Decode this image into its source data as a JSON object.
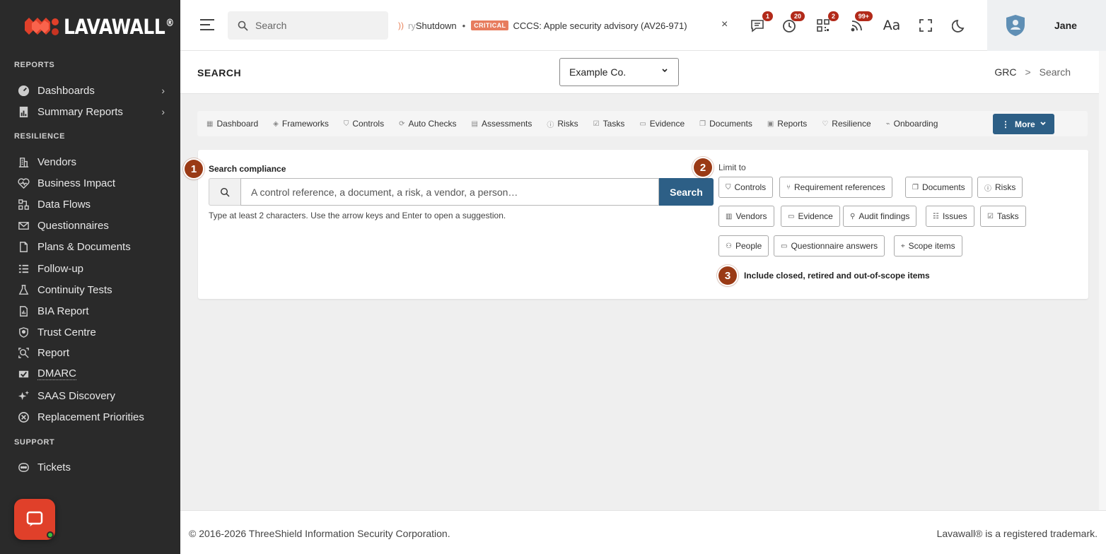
{
  "app": {
    "brand": "LAVAWALL",
    "brand_reg": "®",
    "brand_color": "#e0402a"
  },
  "sidebar": {
    "sections": {
      "reports": "REPORTS",
      "resilience": "RESILIENCE",
      "support": "SUPPORT"
    },
    "items": [
      {
        "label": "Dashboards",
        "icon": "gauge-icon"
      },
      {
        "label": "Summary Reports",
        "icon": "report-icon"
      },
      {
        "label": "Vendors",
        "icon": "building-icon"
      },
      {
        "label": "Business Impact",
        "icon": "heart-pulse-icon"
      },
      {
        "label": "Data Flows",
        "icon": "flow-icon"
      },
      {
        "label": "Questionnaires",
        "icon": "envelope-icon"
      },
      {
        "label": "Plans & Documents",
        "icon": "document-icon"
      },
      {
        "label": "Follow-up",
        "icon": "list-icon"
      },
      {
        "label": "Continuity Tests",
        "icon": "flask-icon"
      },
      {
        "label": "BIA Report",
        "icon": "chart-icon"
      },
      {
        "label": "Trust Centre",
        "icon": "shield-icon"
      },
      {
        "label": "Report",
        "icon": "search-report-icon"
      },
      {
        "label": "DMARC",
        "icon": "mail-check-icon"
      },
      {
        "label": "SAAS Discovery",
        "icon": "sparkle-icon"
      },
      {
        "label": "Replacement Priorities",
        "icon": "priority-icon"
      },
      {
        "label": "Tickets",
        "icon": "ticket-icon"
      }
    ]
  },
  "topbar": {
    "search_placeholder": "Search",
    "ticker": {
      "faded_prefix": "ry",
      "first_item": "Shutdown",
      "severity": "CRITICAL",
      "second_item": "CCCS: Apple security advisory (AV26-971)",
      "close": "×"
    },
    "badges": {
      "messages": "1",
      "timer": "20",
      "qr": "2",
      "feeds": "99+"
    },
    "font_icon_text": "Aa",
    "user_name": "Jane"
  },
  "page": {
    "title": "SEARCH",
    "company": "Example Co.",
    "breadcrumb": [
      "GRC",
      "Search"
    ],
    "breadcrumb_sep": ">"
  },
  "tabs": [
    {
      "label": "Dashboard",
      "icon": "grid-icon"
    },
    {
      "label": "Frameworks",
      "icon": "layers-icon"
    },
    {
      "label": "Controls",
      "icon": "shield-check-icon"
    },
    {
      "label": "Auto Checks",
      "icon": "auto-icon"
    },
    {
      "label": "Assessments",
      "icon": "clipboard-icon"
    },
    {
      "label": "Risks",
      "icon": "alert-icon"
    },
    {
      "label": "Tasks",
      "icon": "checkbox-icon"
    },
    {
      "label": "Evidence",
      "icon": "folder-icon"
    },
    {
      "label": "Documents",
      "icon": "docs-icon"
    },
    {
      "label": "Reports",
      "icon": "report-icon"
    },
    {
      "label": "Resilience",
      "icon": "heart-icon"
    },
    {
      "label": "Onboarding",
      "icon": "onboarding-icon"
    }
  ],
  "more_button": "More",
  "search_panel": {
    "steps": [
      "1",
      "2",
      "3"
    ],
    "label": "Search compliance",
    "placeholder": "A control reference, a document, a risk, a vendor, a person…",
    "button": "Search",
    "hint": "Type at least 2 characters. Use the arrow keys and Enter to open a suggestion.",
    "limit_label": "Limit to",
    "filters": [
      {
        "label": "Controls",
        "icon": "shield-check-icon"
      },
      {
        "label": "Requirement references",
        "icon": "branch-icon"
      },
      {
        "label": "Documents",
        "icon": "docs-icon"
      },
      {
        "label": "Risks",
        "icon": "alert-icon"
      },
      {
        "label": "Vendors",
        "icon": "building-icon"
      },
      {
        "label": "Evidence",
        "icon": "folder-icon"
      },
      {
        "label": "Audit findings",
        "icon": "pin-icon"
      },
      {
        "label": "Issues",
        "icon": "list-icon"
      },
      {
        "label": "Tasks",
        "icon": "checkbox-icon"
      },
      {
        "label": "People",
        "icon": "people-icon"
      },
      {
        "label": "Questionnaire answers",
        "icon": "comment-icon"
      },
      {
        "label": "Scope items",
        "icon": "target-icon"
      }
    ],
    "include_label": "Include closed, retired and out-of-scope items"
  },
  "footer": {
    "copyright": "© 2016-2026 ThreeShield Information Security Corporation.",
    "trademark": "Lavawall® is a registered trademark."
  },
  "colors": {
    "sidebar_bg": "#2a2a2a",
    "primary_button": "#2d5f86",
    "step_badge": "#9a3a15",
    "critical_tag": "#e77c5e",
    "notification_badge": "#b22a1a"
  }
}
